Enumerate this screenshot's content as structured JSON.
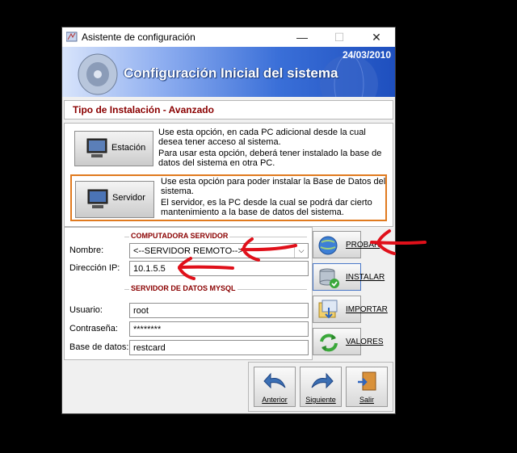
{
  "window": {
    "title": "Asistente de configuración",
    "minimize": "—",
    "maximize": "☐",
    "close": "✕"
  },
  "banner": {
    "date": "24/03/2010",
    "title": "Configuración Inicial del sistema"
  },
  "install_type": "Tipo de Instalación - Avanzado",
  "options": {
    "station": {
      "label": "Estación",
      "desc": [
        "Use esta opción, en cada PC adicional desde la cual",
        "desea tener acceso al sistema.",
        "Para usar esta opción, deberá tener instalado la base de",
        "datos del sistema en otra PC."
      ]
    },
    "server": {
      "label": "Servidor",
      "desc": [
        "Use esta opción para poder instalar la Base de Datos del",
        "sistema.",
        "El servidor, es la PC desde la cual se podrá dar cierto",
        "mantenimiento a la base de datos del sistema."
      ]
    }
  },
  "server_section": {
    "legend": "COMPUTADORA SERVIDOR",
    "name_label": "Nombre:",
    "name_value": "<--SERVIDOR REMOTO-->",
    "ip_label": "Dirección IP:",
    "ip_value": "10.1.5.5"
  },
  "db_section": {
    "legend": "SERVIDOR DE DATOS MYSQL",
    "user_label": "Usuario:",
    "user_value": "root",
    "pass_label": "Contraseña:",
    "pass_value": "********",
    "db_label": "Base de datos:",
    "db_value": "restcard"
  },
  "side_buttons": {
    "test": "PROBAR",
    "install": "INSTALAR",
    "import": "IMPORTAR",
    "values": "VALORES"
  },
  "nav": {
    "back": "Anterior",
    "next": "Siguiente",
    "exit": "Salir"
  },
  "colors": {
    "banner_start": "#d8e4fb",
    "banner_end": "#1e4fbe",
    "section_red": "#8a0000",
    "annotation_red": "#e0101a",
    "highlight_orange": "#e07a1f"
  }
}
